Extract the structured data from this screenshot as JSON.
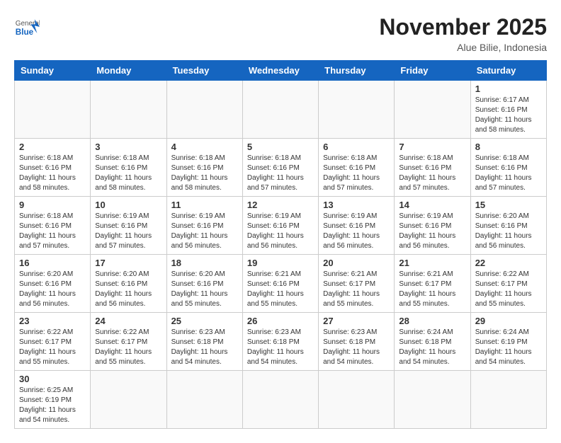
{
  "header": {
    "logo_general": "General",
    "logo_blue": "Blue",
    "month_title": "November 2025",
    "subtitle": "Alue Bilie, Indonesia"
  },
  "weekdays": [
    "Sunday",
    "Monday",
    "Tuesday",
    "Wednesday",
    "Thursday",
    "Friday",
    "Saturday"
  ],
  "weeks": [
    [
      {
        "day": "",
        "info": ""
      },
      {
        "day": "",
        "info": ""
      },
      {
        "day": "",
        "info": ""
      },
      {
        "day": "",
        "info": ""
      },
      {
        "day": "",
        "info": ""
      },
      {
        "day": "",
        "info": ""
      },
      {
        "day": "1",
        "info": "Sunrise: 6:17 AM\nSunset: 6:16 PM\nDaylight: 11 hours\nand 58 minutes."
      }
    ],
    [
      {
        "day": "2",
        "info": "Sunrise: 6:18 AM\nSunset: 6:16 PM\nDaylight: 11 hours\nand 58 minutes."
      },
      {
        "day": "3",
        "info": "Sunrise: 6:18 AM\nSunset: 6:16 PM\nDaylight: 11 hours\nand 58 minutes."
      },
      {
        "day": "4",
        "info": "Sunrise: 6:18 AM\nSunset: 6:16 PM\nDaylight: 11 hours\nand 58 minutes."
      },
      {
        "day": "5",
        "info": "Sunrise: 6:18 AM\nSunset: 6:16 PM\nDaylight: 11 hours\nand 57 minutes."
      },
      {
        "day": "6",
        "info": "Sunrise: 6:18 AM\nSunset: 6:16 PM\nDaylight: 11 hours\nand 57 minutes."
      },
      {
        "day": "7",
        "info": "Sunrise: 6:18 AM\nSunset: 6:16 PM\nDaylight: 11 hours\nand 57 minutes."
      },
      {
        "day": "8",
        "info": "Sunrise: 6:18 AM\nSunset: 6:16 PM\nDaylight: 11 hours\nand 57 minutes."
      }
    ],
    [
      {
        "day": "9",
        "info": "Sunrise: 6:18 AM\nSunset: 6:16 PM\nDaylight: 11 hours\nand 57 minutes."
      },
      {
        "day": "10",
        "info": "Sunrise: 6:19 AM\nSunset: 6:16 PM\nDaylight: 11 hours\nand 57 minutes."
      },
      {
        "day": "11",
        "info": "Sunrise: 6:19 AM\nSunset: 6:16 PM\nDaylight: 11 hours\nand 56 minutes."
      },
      {
        "day": "12",
        "info": "Sunrise: 6:19 AM\nSunset: 6:16 PM\nDaylight: 11 hours\nand 56 minutes."
      },
      {
        "day": "13",
        "info": "Sunrise: 6:19 AM\nSunset: 6:16 PM\nDaylight: 11 hours\nand 56 minutes."
      },
      {
        "day": "14",
        "info": "Sunrise: 6:19 AM\nSunset: 6:16 PM\nDaylight: 11 hours\nand 56 minutes."
      },
      {
        "day": "15",
        "info": "Sunrise: 6:20 AM\nSunset: 6:16 PM\nDaylight: 11 hours\nand 56 minutes."
      }
    ],
    [
      {
        "day": "16",
        "info": "Sunrise: 6:20 AM\nSunset: 6:16 PM\nDaylight: 11 hours\nand 56 minutes."
      },
      {
        "day": "17",
        "info": "Sunrise: 6:20 AM\nSunset: 6:16 PM\nDaylight: 11 hours\nand 56 minutes."
      },
      {
        "day": "18",
        "info": "Sunrise: 6:20 AM\nSunset: 6:16 PM\nDaylight: 11 hours\nand 55 minutes."
      },
      {
        "day": "19",
        "info": "Sunrise: 6:21 AM\nSunset: 6:16 PM\nDaylight: 11 hours\nand 55 minutes."
      },
      {
        "day": "20",
        "info": "Sunrise: 6:21 AM\nSunset: 6:17 PM\nDaylight: 11 hours\nand 55 minutes."
      },
      {
        "day": "21",
        "info": "Sunrise: 6:21 AM\nSunset: 6:17 PM\nDaylight: 11 hours\nand 55 minutes."
      },
      {
        "day": "22",
        "info": "Sunrise: 6:22 AM\nSunset: 6:17 PM\nDaylight: 11 hours\nand 55 minutes."
      }
    ],
    [
      {
        "day": "23",
        "info": "Sunrise: 6:22 AM\nSunset: 6:17 PM\nDaylight: 11 hours\nand 55 minutes."
      },
      {
        "day": "24",
        "info": "Sunrise: 6:22 AM\nSunset: 6:17 PM\nDaylight: 11 hours\nand 55 minutes."
      },
      {
        "day": "25",
        "info": "Sunrise: 6:23 AM\nSunset: 6:18 PM\nDaylight: 11 hours\nand 54 minutes."
      },
      {
        "day": "26",
        "info": "Sunrise: 6:23 AM\nSunset: 6:18 PM\nDaylight: 11 hours\nand 54 minutes."
      },
      {
        "day": "27",
        "info": "Sunrise: 6:23 AM\nSunset: 6:18 PM\nDaylight: 11 hours\nand 54 minutes."
      },
      {
        "day": "28",
        "info": "Sunrise: 6:24 AM\nSunset: 6:18 PM\nDaylight: 11 hours\nand 54 minutes."
      },
      {
        "day": "29",
        "info": "Sunrise: 6:24 AM\nSunset: 6:19 PM\nDaylight: 11 hours\nand 54 minutes."
      }
    ],
    [
      {
        "day": "30",
        "info": "Sunrise: 6:25 AM\nSunset: 6:19 PM\nDaylight: 11 hours\nand 54 minutes."
      },
      {
        "day": "",
        "info": ""
      },
      {
        "day": "",
        "info": ""
      },
      {
        "day": "",
        "info": ""
      },
      {
        "day": "",
        "info": ""
      },
      {
        "day": "",
        "info": ""
      },
      {
        "day": "",
        "info": ""
      }
    ]
  ]
}
